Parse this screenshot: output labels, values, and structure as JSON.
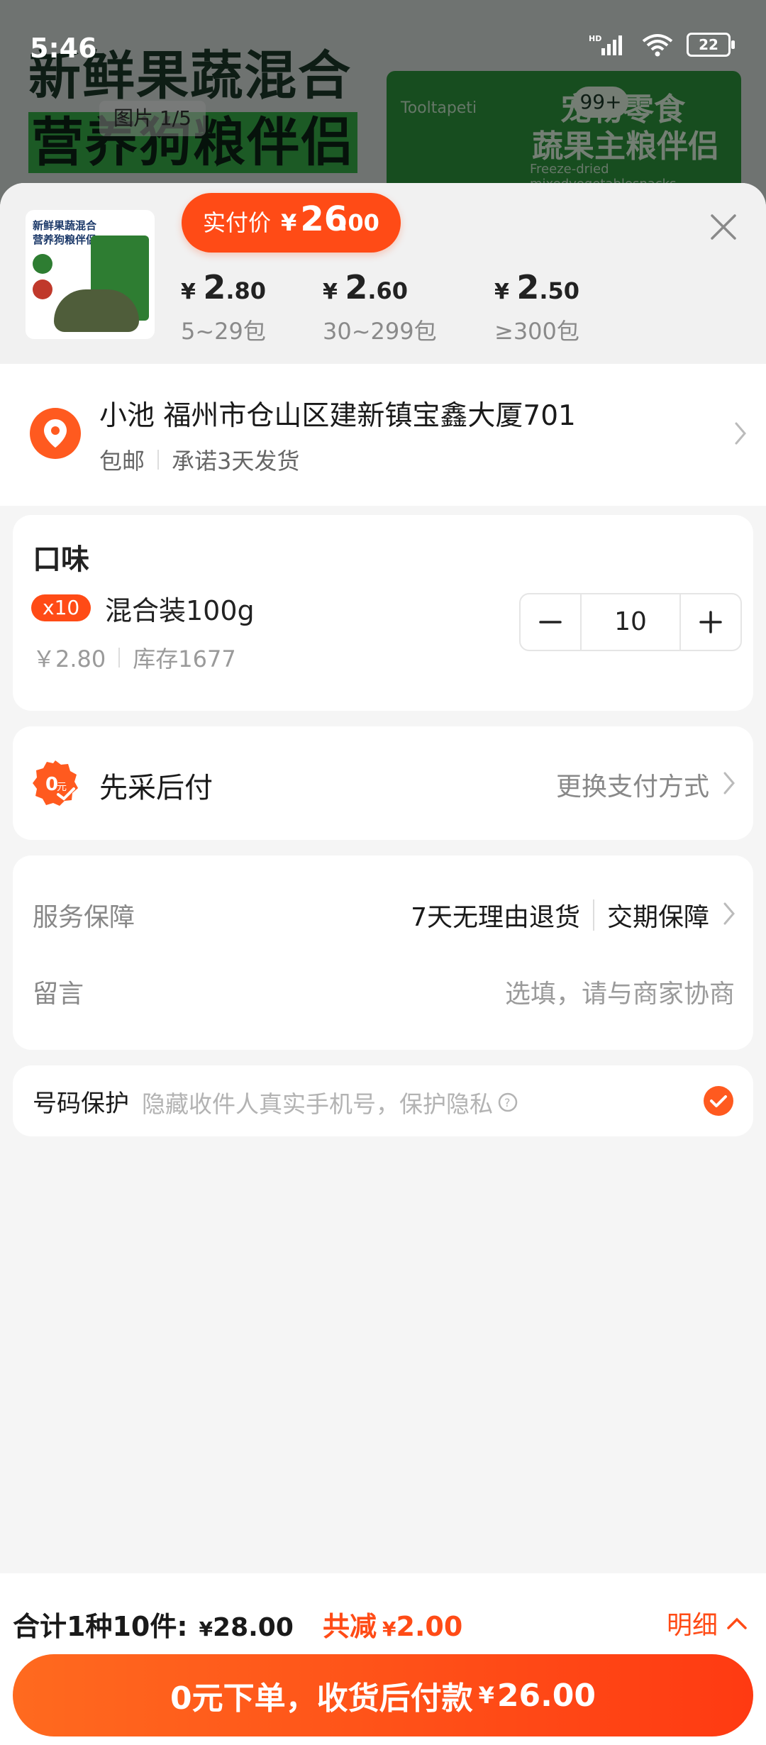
{
  "status_bar": {
    "time": "5:46",
    "battery": "22"
  },
  "background": {
    "headline_line1": "新鲜果蔬混合",
    "headline_line2": "营养狗粮伴侣",
    "image_counter": "图片 1/5",
    "cart_badge": "99+",
    "pack_title1": "宠物零食",
    "pack_title2": "蔬果主粮伴侣",
    "pack_subtitle": "Freeze-dried mixedvegetablesnacks",
    "pack_brand": "Tooltapeti"
  },
  "header": {
    "pay_label": "实付价",
    "pay_currency": "¥",
    "pay_int": "26",
    "pay_dec": ".00",
    "thumb_title1": "新鲜果蔬混合",
    "thumb_title2": "营养狗粮伴侣"
  },
  "price_tiers": [
    {
      "currency": "¥",
      "int": "2",
      "dec": ".80",
      "range": "5~29包"
    },
    {
      "currency": "¥",
      "int": "2",
      "dec": ".60",
      "range": "30~299包"
    },
    {
      "currency": "¥",
      "int": "2",
      "dec": ".50",
      "range": "≥300包"
    }
  ],
  "address": {
    "line": "小池 福州市仓山区建新镇宝鑫大厦701",
    "shipping": "包邮",
    "promise": "承诺3天发货"
  },
  "flavor": {
    "title": "口味",
    "qty_badge": "x10",
    "sku_name": "混合装100g",
    "sku_price": "￥2.80",
    "stock": "库存1677",
    "quantity": "10"
  },
  "payment": {
    "title": "先采后付",
    "change": "更换支付方式"
  },
  "service": {
    "label": "服务保障",
    "return_policy": "7天无理由退货",
    "delivery_guarantee": "交期保障",
    "note_label": "留言",
    "note_placeholder": "选填，请与商家协商"
  },
  "phone_protect": {
    "label": "号码保护",
    "desc": "隐藏收件人真实手机号，保护隐私",
    "checked": true
  },
  "bottom": {
    "total_label": "合计1种10件:",
    "total_currency": "¥",
    "total_amount": "28.00",
    "saving_label": "共减",
    "saving_currency": "¥",
    "saving_amount": "2.00",
    "detail": "明细",
    "order_label": "0元下单，收货后付款",
    "order_currency": "¥",
    "order_amount": "26.00"
  },
  "colors": {
    "accent": "#ff4b16",
    "gray_text": "#888888"
  }
}
